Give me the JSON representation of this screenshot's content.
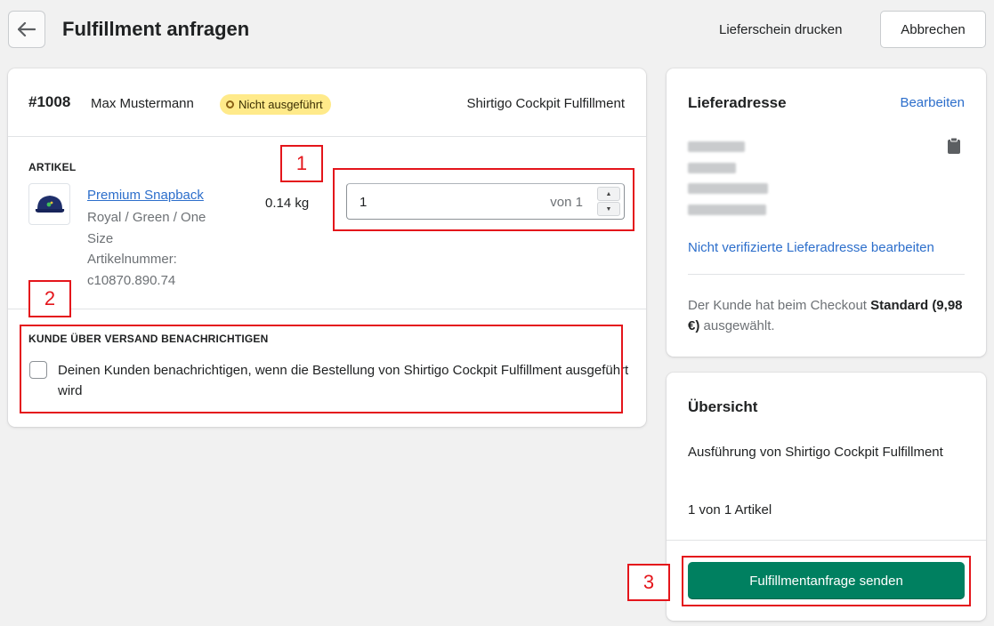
{
  "header": {
    "title": "Fulfillment anfragen",
    "print_label": "Lieferschein drucken",
    "cancel_label": "Abbrechen"
  },
  "order": {
    "number": "#1008",
    "customer": "Max Mustermann",
    "status": "Nicht ausgeführt",
    "provider": "Shirtigo Cockpit Fulfillment"
  },
  "items": {
    "section_label": "ARTIKEL",
    "product_name": "Premium Snapback",
    "variant": "Royal / Green / One Size",
    "sku": "Artikelnummer: c10870.890.74",
    "weight": "0.14 kg",
    "quantity_value": "1",
    "quantity_of": "von 1"
  },
  "notify": {
    "section_label": "KUNDE ÜBER VERSAND BENACHRICHTIGEN",
    "checkbox_label": "Deinen Kunden benachrichtigen, wenn die Bestellung von Shirtigo Cockpit Fulfillment ausgeführt wird",
    "checked": false
  },
  "address": {
    "title": "Lieferadresse",
    "edit_label": "Bearbeiten",
    "unverified_link": "Nicht verifizierte Lieferadresse bearbeiten",
    "checkout_prefix": "Der Kunde hat beim Checkout ",
    "checkout_method": "Standard",
    "checkout_price": "(9,98 €)",
    "checkout_suffix": " ausgewählt."
  },
  "summary": {
    "title": "Übersicht",
    "execution": "Ausführung von Shirtigo Cockpit Fulfillment",
    "count": "1 von 1 Artikel",
    "send_label": "Fulfillmentanfrage senden"
  },
  "annotations": {
    "label_1": "1",
    "label_2": "2",
    "label_3": "3"
  },
  "colors": {
    "primary": "#008060",
    "link": "#2c6ecb",
    "badge_bg": "#ffea8a",
    "annotation": "#e4151b"
  }
}
